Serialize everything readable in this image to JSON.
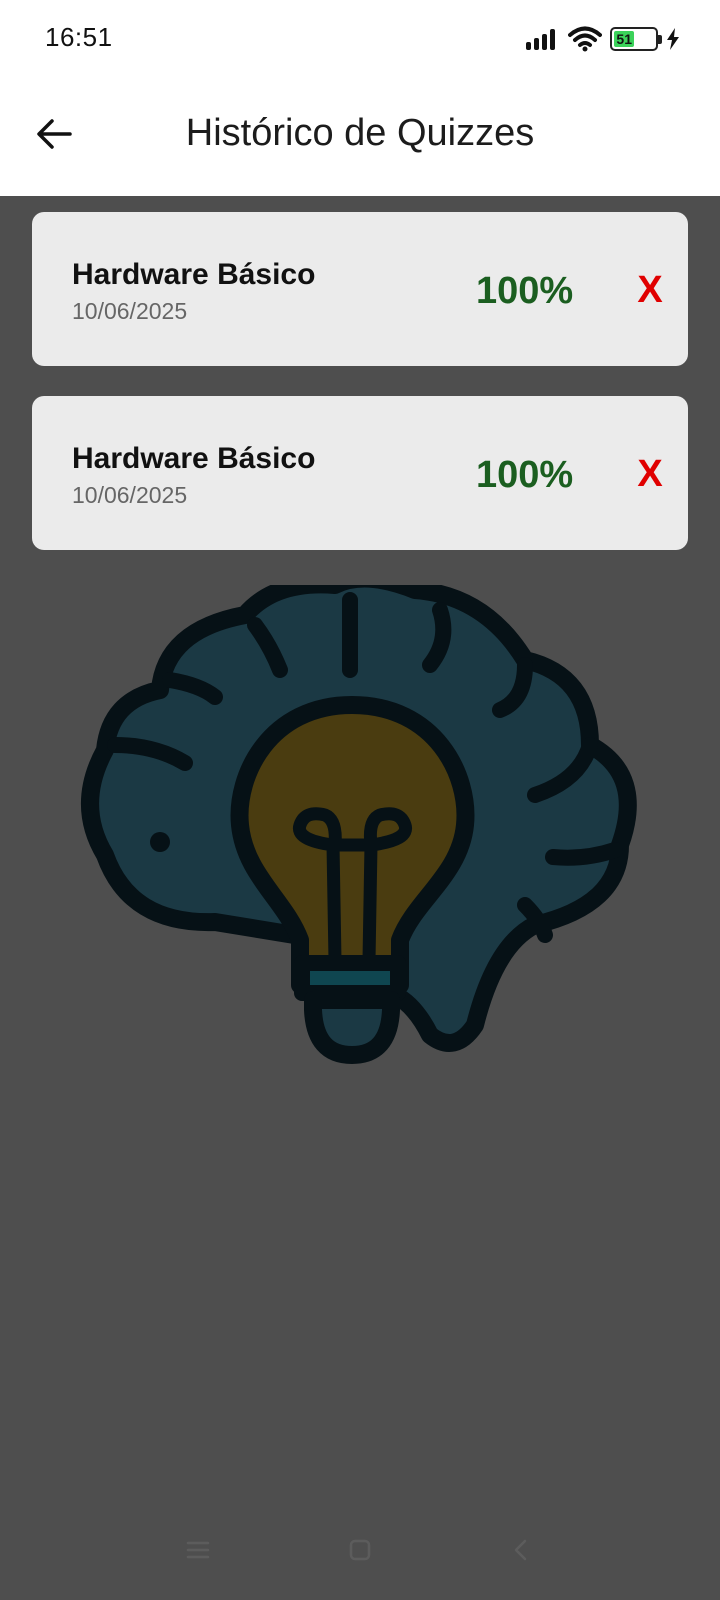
{
  "status_bar": {
    "time": "16:51",
    "battery_level": "51",
    "icons": [
      "signal-icon",
      "wifi-icon",
      "battery-icon",
      "charging-bolt-icon"
    ]
  },
  "app_bar": {
    "title": "Histórico de Quizzes",
    "back_icon": "arrow-left-icon"
  },
  "quiz_history": [
    {
      "title": "Hardware Básico",
      "date": "10/06/2025",
      "score": "100%",
      "delete_label": "X"
    },
    {
      "title": "Hardware Básico",
      "date": "10/06/2025",
      "score": "100%",
      "delete_label": "X"
    }
  ],
  "illustration": {
    "icon": "brain-lightbulb-icon"
  },
  "nav_bar": {
    "icons": [
      "menu-icon",
      "home-icon",
      "back-icon"
    ]
  },
  "colors": {
    "overlay_background": "#4e4e4e",
    "card_background": "#ebebeb",
    "score_color": "#1b5e20",
    "delete_color": "#e00000",
    "battery_color": "#3bd25a"
  }
}
